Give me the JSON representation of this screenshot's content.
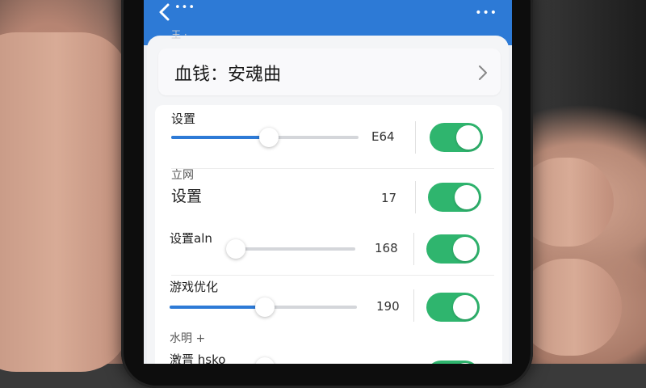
{
  "header": {
    "title": "血钱：安魂曲",
    "sub_text": "王 ·"
  },
  "topbar": {
    "left_dots": "•••",
    "right_dots": "•••"
  },
  "rows": [
    {
      "label": "设置",
      "value": "E64",
      "slider_level": 0.52,
      "toggle_on": true
    },
    {
      "section": "立网",
      "label": "设置",
      "value": "17",
      "toggle_on": true
    },
    {
      "label": "设置aln",
      "value": "168",
      "slider_level": 0.04,
      "toggle_on": true
    },
    {
      "label": "游戏优化",
      "value": "190",
      "slider_level": 0.51,
      "toggle_on": true
    },
    {
      "section": "水明 +",
      "label": "激晋 hsko",
      "toggle_on": true
    }
  ],
  "colors": {
    "topbar": "#2d7ad6",
    "toggle_on": "#2fb56e",
    "slider_fill": "#2d7ad6"
  }
}
